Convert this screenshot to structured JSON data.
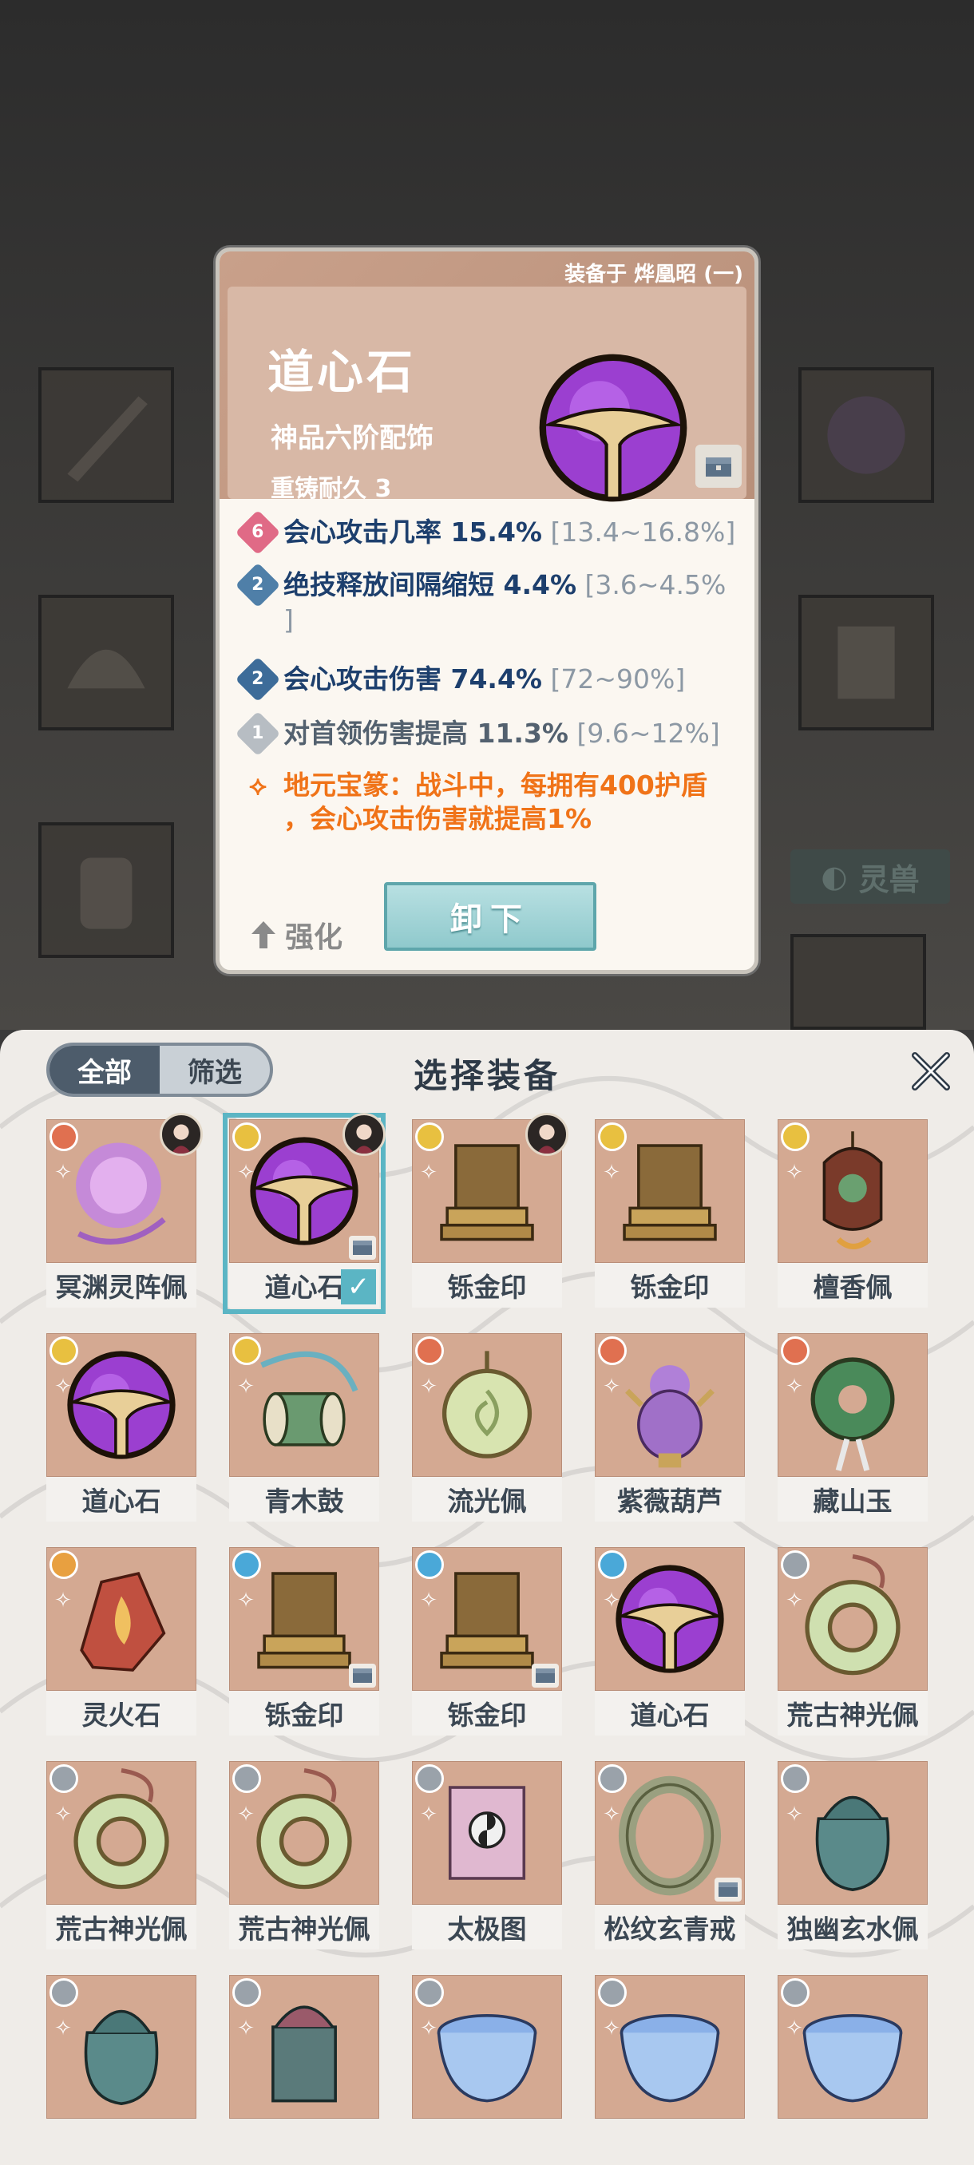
{
  "detail": {
    "equipped_on": "装备于 烨凰昭 (一)",
    "name": "道心石",
    "tier": "神品六阶配饰",
    "durability": "重铸耐久 3",
    "stats": [
      {
        "badge": "6",
        "badge_color": "#e06a86",
        "text": "会心攻击几率 15.4%",
        "range": "[13.4~16.8%]"
      },
      {
        "badge": "2",
        "badge_color": "#4f7fa8",
        "text": "绝技释放间隔缩短 4.4%",
        "range": "[3.6~4.5%",
        "cont": "]"
      },
      {
        "badge": "2",
        "badge_color": "#3d6c99",
        "text": "会心攻击伤害 74.4%",
        "range": "[72~90%]"
      },
      {
        "badge": "1",
        "badge_color": "#b7bdc3",
        "text": "对首领伤害提高 11.3%",
        "range": "[9.6~12%]"
      }
    ],
    "special_line1": "地元宝篆：战斗中，每拥有400护盾",
    "special_line2": "，会心攻击伤害就提高1%",
    "strengthen_label": "强化",
    "unequip_label": "卸下"
  },
  "background": {
    "spirit_beast_label": "灵兽"
  },
  "panel": {
    "tab_all": "全部",
    "tab_filter": "筛选",
    "title": "选择装备"
  },
  "items": [
    {
      "name": "冥渊灵阵佩",
      "rank_color": "#e07050",
      "art": "orb-pink",
      "avatar": true
    },
    {
      "name": "道心石",
      "rank_color": "#e8c040",
      "art": "orb",
      "avatar": true,
      "selected": true,
      "locked": true
    },
    {
      "name": "铄金印",
      "rank_color": "#e8c040",
      "art": "seal",
      "avatar": true
    },
    {
      "name": "铄金印",
      "rank_color": "#e8c040",
      "art": "seal"
    },
    {
      "name": "檀香佩",
      "rank_color": "#e8c040",
      "art": "pendant-red"
    },
    {
      "name": "道心石",
      "rank_color": "#e8c040",
      "art": "orb"
    },
    {
      "name": "青木鼓",
      "rank_color": "#e8c040",
      "art": "drum"
    },
    {
      "name": "流光佩",
      "rank_color": "#e07050",
      "art": "jade"
    },
    {
      "name": "紫薇葫芦",
      "rank_color": "#e07050",
      "art": "gourd"
    },
    {
      "name": "藏山玉",
      "rank_color": "#e07050",
      "art": "jade-green"
    },
    {
      "name": "灵火石",
      "rank_color": "#e8a040",
      "art": "fire"
    },
    {
      "name": "铄金印",
      "rank_color": "#4aa8d8",
      "art": "seal",
      "locked": true
    },
    {
      "name": "铄金印",
      "rank_color": "#4aa8d8",
      "art": "seal",
      "locked": true
    },
    {
      "name": "道心石",
      "rank_color": "#4aa8d8",
      "art": "orb"
    },
    {
      "name": "荒古神光佩",
      "rank_color": "#9aa2aa",
      "art": "pendant-green"
    },
    {
      "name": "荒古神光佩",
      "rank_color": "#9aa2aa",
      "art": "pendant-green"
    },
    {
      "name": "荒古神光佩",
      "rank_color": "#9aa2aa",
      "art": "pendant-green"
    },
    {
      "name": "太极图",
      "rank_color": "#9aa2aa",
      "art": "scroll"
    },
    {
      "name": "松纹玄青戒",
      "rank_color": "#9aa2aa",
      "art": "ring",
      "locked": true
    },
    {
      "name": "独幽玄水佩",
      "rank_color": "#9aa2aa",
      "art": "urn"
    },
    {
      "name": "",
      "rank_color": "#9aa2aa",
      "art": "urn"
    },
    {
      "name": "",
      "rank_color": "#9aa2aa",
      "art": "urn-red"
    },
    {
      "name": "",
      "rank_color": "#9aa2aa",
      "art": "bowl"
    },
    {
      "name": "",
      "rank_color": "#9aa2aa",
      "art": "bowl"
    },
    {
      "name": "",
      "rank_color": "#9aa2aa",
      "art": "bowl"
    }
  ]
}
